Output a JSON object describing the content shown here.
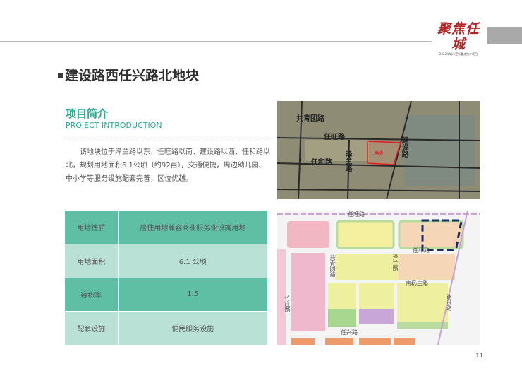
{
  "header": {
    "logo_text": "聚焦任城",
    "logo_subtitle": "2022年城市更新重点推介项目"
  },
  "page_title": "建设路西任兴路北地块",
  "section": {
    "title": "项目简介",
    "subtitle": "PROJECT INTRODUCTION",
    "body": "该地块位于泽兰路以东、任旺路以南、建设路以西、任和路以北，规划用地面积6.1公顷（约92亩），交通便捷，周边幼儿园、中小学等服务设施配套完善，区位优越。"
  },
  "table": [
    {
      "key": "用地性质",
      "value": "居住用地兼容商业服务业设施用地"
    },
    {
      "key": "用地面积",
      "value": "6.1 公顷"
    },
    {
      "key": "容积率",
      "value": "1.5"
    },
    {
      "key": "配套设施",
      "value": "便民服务设施"
    }
  ],
  "aerial_map": {
    "roads": [
      "共青团路",
      "任旺路",
      "任和路",
      "泽兰路",
      "建设路"
    ],
    "site_label": "地块"
  },
  "plan_map": {
    "roads": [
      "任旺路",
      "任和路",
      "共青团路",
      "泽兰路",
      "南杨庄路",
      "任兴路",
      "建设路",
      "竹庄路"
    ]
  },
  "page_number": "11",
  "colors": {
    "accent": "#2bab91",
    "table_dark": "#5fbfa5",
    "table_light": "#b9e1d6",
    "logo": "#b32525"
  }
}
